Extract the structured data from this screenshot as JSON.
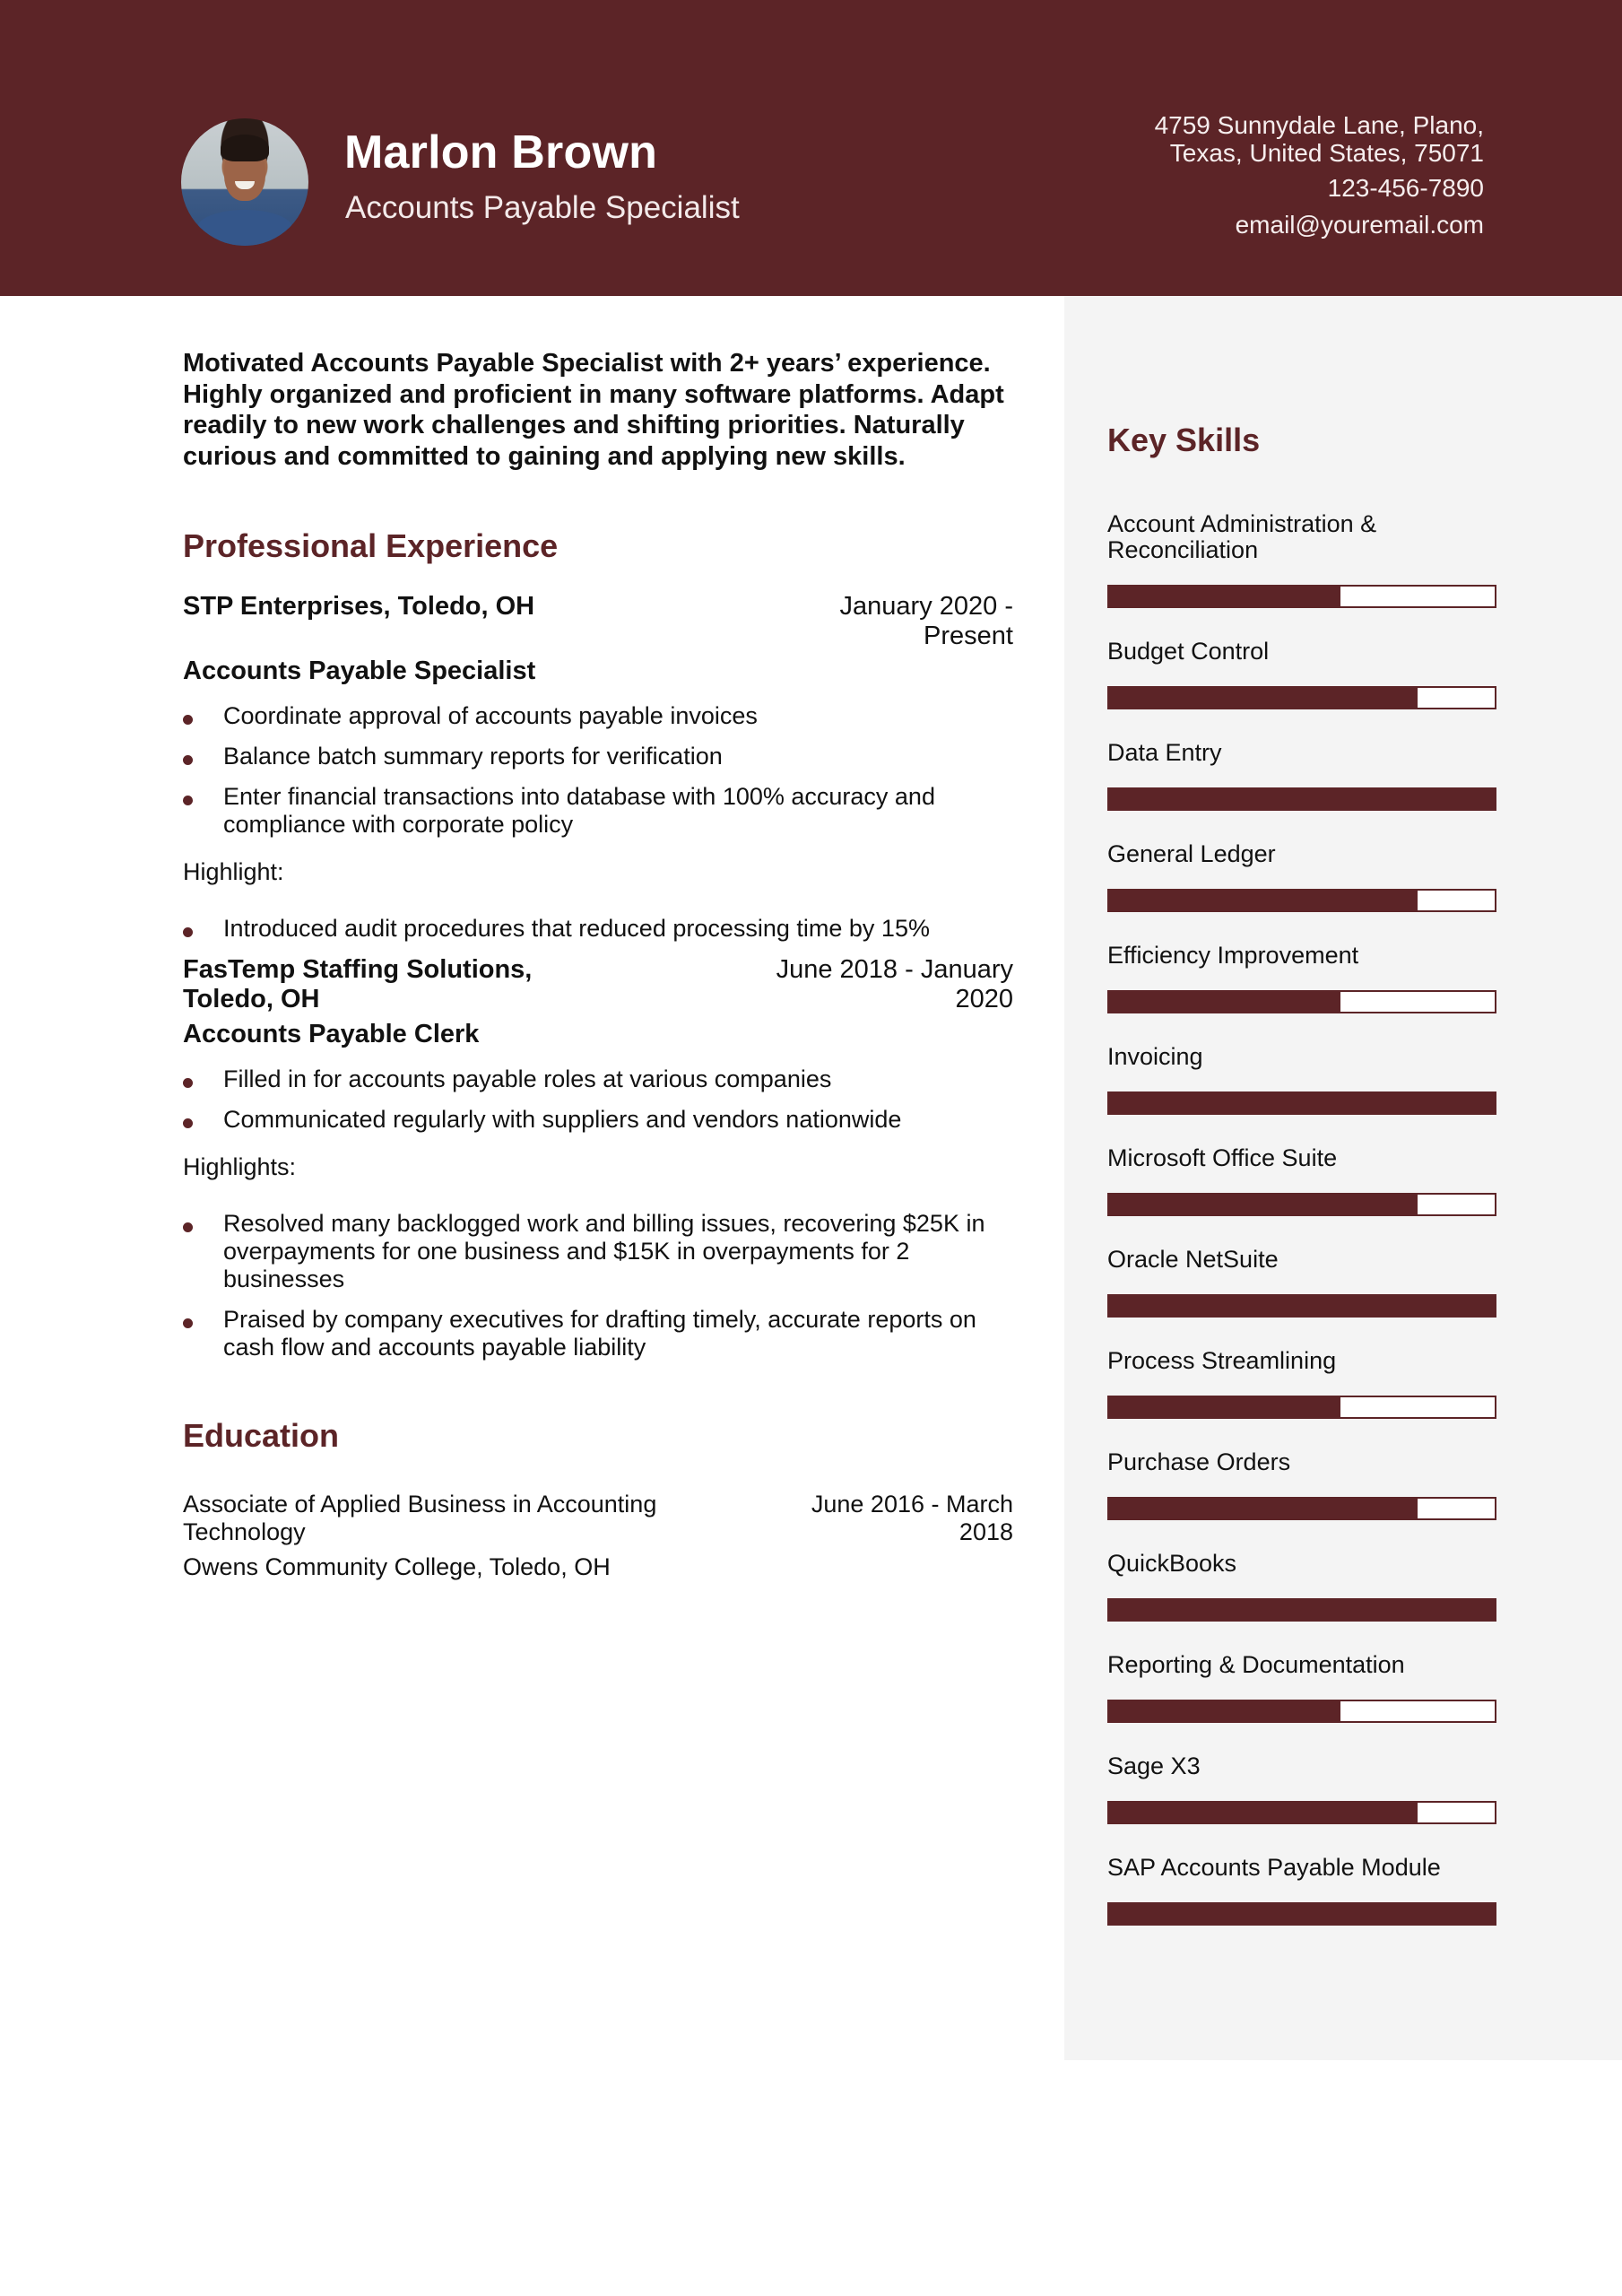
{
  "header": {
    "name": "Marlon Brown",
    "title": "Accounts Payable Specialist",
    "address_line1": "4759 Sunnydale Lane, Plano,",
    "address_line2": "Texas, United States, 75071",
    "phone": "123-456-7890",
    "email": "email@youremail.com",
    "photo": "profile-photo"
  },
  "colors": {
    "accent": "#5c2427",
    "sidebar_bg": "#f4f4f4",
    "text": "#111111"
  },
  "summary": "Motivated Accounts Payable Specialist with 2+ years’ experience. Highly organized and proficient in many software platforms. Adapt readily to new work challenges and shifting priorities. Naturally curious and committed to gaining and applying new skills.",
  "experience": {
    "heading": "Professional Experience",
    "jobs": [
      {
        "company": "STP Enterprises, Toledo, OH",
        "dates": "January 2020 - Present",
        "role": "Accounts Payable Specialist",
        "bullets": [
          "Coordinate approval of accounts payable invoices",
          "Balance batch summary reports for verification",
          "Enter financial transactions into database with 100% accuracy and compliance with corporate policy"
        ],
        "highlight_label": "Highlight:",
        "highlights": [
          "Introduced audit procedures that reduced processing time by 15%"
        ]
      },
      {
        "company": "FasTemp Staffing Solutions, Toledo, OH",
        "dates": "June 2018 - January 2020",
        "role": "Accounts Payable Clerk",
        "bullets": [
          "Filled in for accounts payable roles at various companies",
          "Communicated regularly with suppliers and vendors nationwide"
        ],
        "highlight_label": "Highlights:",
        "highlights": [
          "Resolved many backlogged work and billing issues, recovering $25K in overpayments for one business and $15K in overpayments for 2 businesses",
          "Praised by company executives for drafting timely, accurate reports on cash flow and accounts payable liability"
        ]
      }
    ]
  },
  "education": {
    "heading": "Education",
    "degree": "Associate of Applied Business in Accounting Technology",
    "dates": "June 2016 - March 2018",
    "school": "Owens Community College, Toledo, OH"
  },
  "skills": {
    "heading": "Key Skills",
    "items": [
      {
        "name": "Account Administration & Reconciliation",
        "level": 0.6
      },
      {
        "name": "Budget Control",
        "level": 0.8
      },
      {
        "name": "Data Entry",
        "level": 1.0
      },
      {
        "name": "General Ledger",
        "level": 0.8
      },
      {
        "name": "Efficiency Improvement",
        "level": 0.6
      },
      {
        "name": "Invoicing",
        "level": 1.0
      },
      {
        "name": "Microsoft Office Suite",
        "level": 0.8
      },
      {
        "name": "Oracle NetSuite",
        "level": 1.0
      },
      {
        "name": "Process Streamlining",
        "level": 0.6
      },
      {
        "name": "Purchase Orders",
        "level": 0.8
      },
      {
        "name": "QuickBooks",
        "level": 1.0
      },
      {
        "name": "Reporting & Documentation",
        "level": 0.6
      },
      {
        "name": "Sage X3",
        "level": 0.8
      },
      {
        "name": "SAP Accounts Payable Module",
        "level": 1.0
      }
    ]
  }
}
